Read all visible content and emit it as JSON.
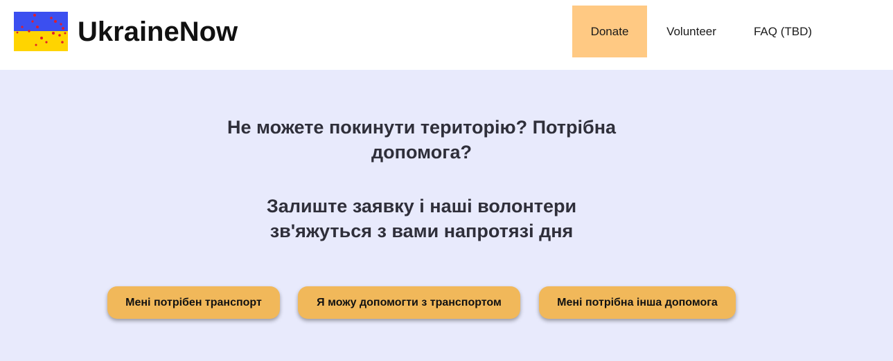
{
  "brand": {
    "name": "UkraineNow",
    "logo_icon": "ukraine-flag-icon",
    "flag_colors": {
      "top": "#3b4ff0",
      "bottom": "#ffd400",
      "dots": "#e01e2a"
    }
  },
  "nav": {
    "items": [
      {
        "label": "Donate",
        "active": true
      },
      {
        "label": "Volunteer"
      },
      {
        "label": "FAQ (TBD)"
      }
    ]
  },
  "hero": {
    "headline_line1": "Не можете покинути територію? Потрібна",
    "headline_line2": "допомога?",
    "subline_line1": "Залиште заявку і наші волонтери",
    "subline_line2": "зв'яжуться з вами напротязі дня"
  },
  "actions": {
    "need_transport": "Мені потрібен транспорт",
    "offer_transport": "Я можу допомогти з транспортом",
    "need_other_help": "Мені потрібна інша допомога"
  },
  "colors": {
    "accent_nav": "#ffc983",
    "button": "#f1b85a",
    "hero_background": "#e8eafc"
  }
}
